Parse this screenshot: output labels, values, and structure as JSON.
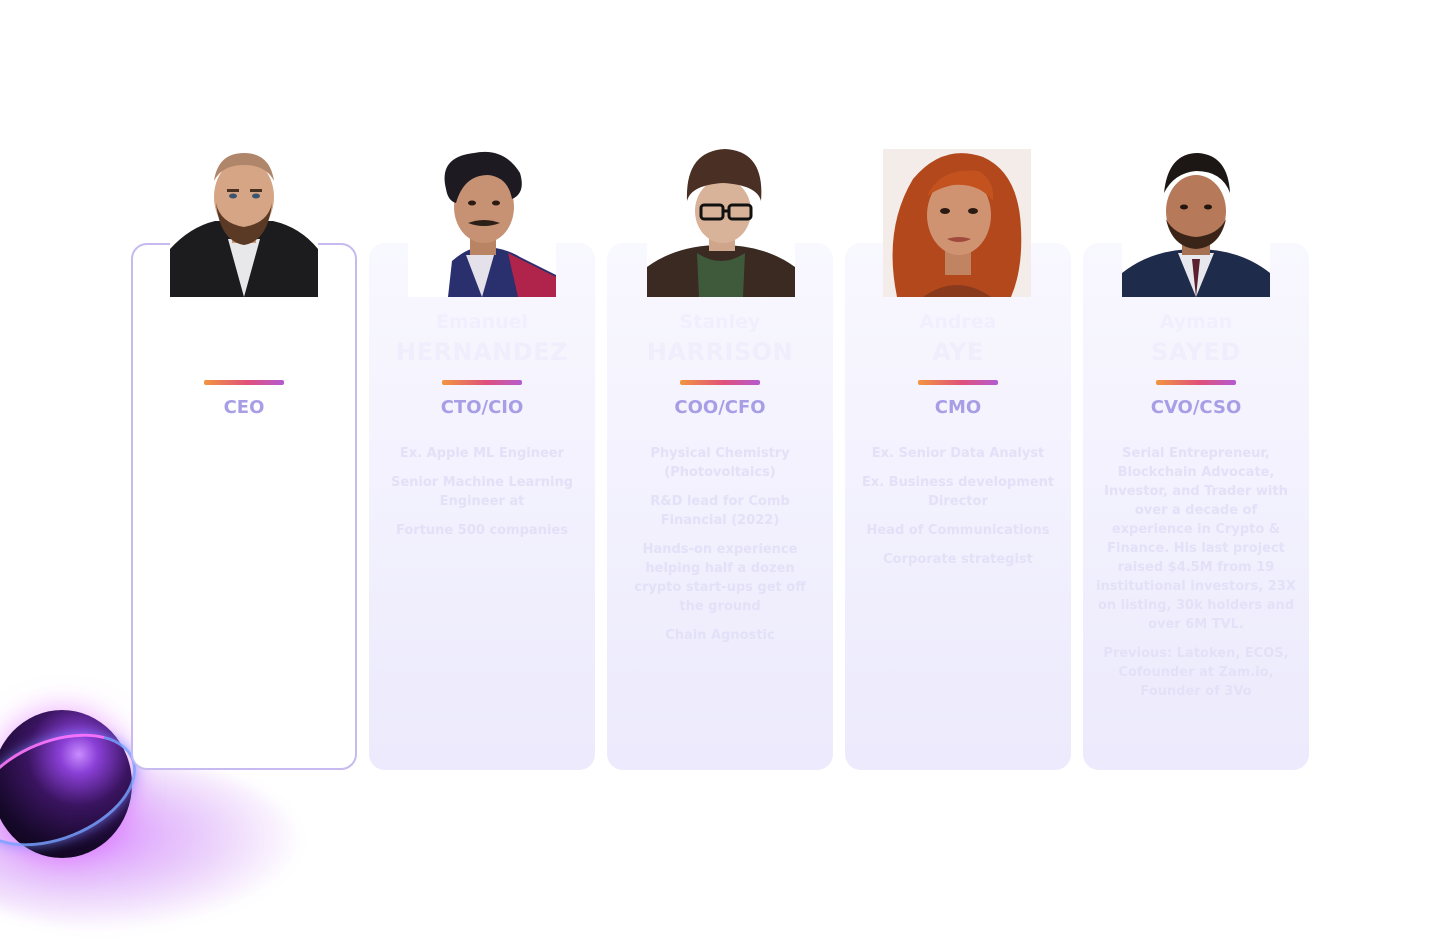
{
  "team": [
    {
      "first_name": "",
      "last_name": "",
      "role": "CEO",
      "bio": []
    },
    {
      "first_name": "Emanuel",
      "last_name": "HERNANDEZ",
      "role": "CTO/CIO",
      "bio": [
        "Ex. Apple ML Engineer",
        "Senior Machine Learning Engineer at",
        "Fortune 500 companies"
      ]
    },
    {
      "first_name": "Stanley",
      "last_name": "HARRISON",
      "role": "COO/CFO",
      "bio": [
        "Physical Chemistry (Photovoltaics)",
        "R&D lead for Comb Financial (2022)",
        "Hands-on experience helping half a dozen crypto start-ups get off the ground",
        "Chain Agnostic"
      ]
    },
    {
      "first_name": "Andrea",
      "last_name": "AYE",
      "role": "CMO",
      "bio": [
        "Ex. Senior Data Analyst",
        "Ex. Business development Director",
        "Head of Communications",
        "Corporate strategist"
      ]
    },
    {
      "first_name": "Ayman",
      "last_name": "SAYED",
      "role": "CVO/CSO",
      "bio": [
        "Serial Entrepreneur, Blockchain Advocate, Investor, and Trader with over a decade of experience in Crypto & Finance. His last project raised $4.5M from 19 institutional investors, 23X on listing, 30k holders and over 6M TVL.",
        "Previous: Latoken, ECOS, Cofounder at Zam.io, Founder of 3Vo"
      ]
    }
  ],
  "colors": {
    "role": "#a89ee6",
    "active_border": "#c7baf0",
    "divider_start": "#f29540",
    "divider_end": "#b45ad2"
  }
}
